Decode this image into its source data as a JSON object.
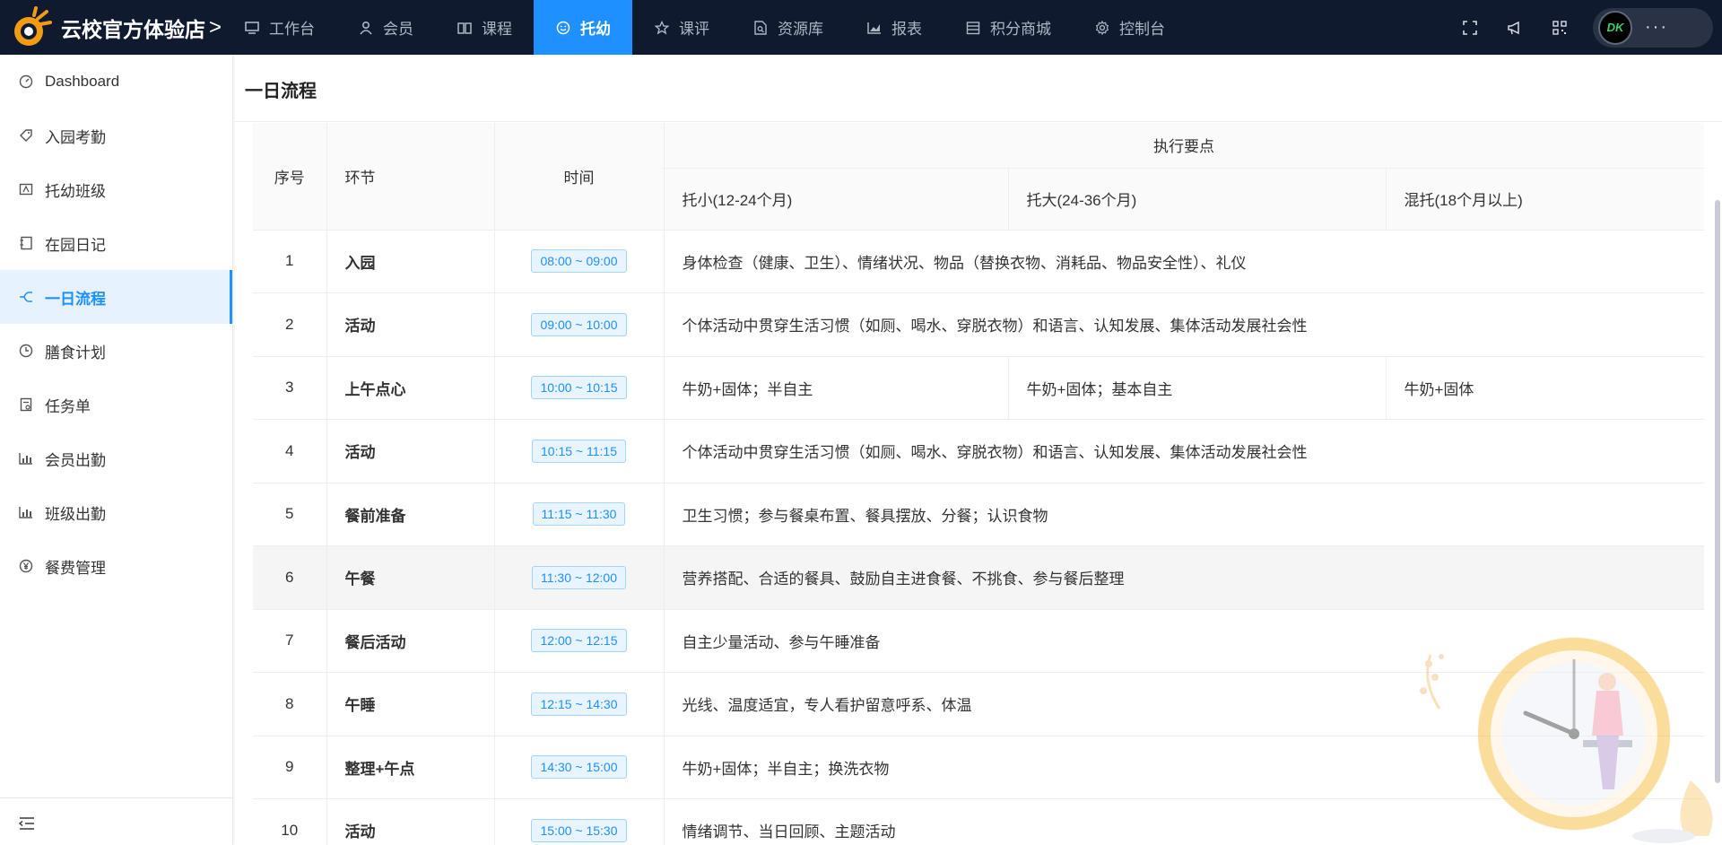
{
  "brand": {
    "name": "云校官方体验店",
    "chevron": ">"
  },
  "nav": [
    {
      "label": "工作台",
      "icon": "monitor-icon",
      "active": false
    },
    {
      "label": "会员",
      "icon": "user-icon",
      "active": false
    },
    {
      "label": "课程",
      "icon": "book-icon",
      "active": false
    },
    {
      "label": "托幼",
      "icon": "smile-icon",
      "active": true
    },
    {
      "label": "课评",
      "icon": "star-icon",
      "active": false
    },
    {
      "label": "资源库",
      "icon": "file-search-icon",
      "active": false
    },
    {
      "label": "报表",
      "icon": "chart-icon",
      "active": false
    },
    {
      "label": "积分商城",
      "icon": "shop-icon",
      "active": false
    },
    {
      "label": "控制台",
      "icon": "gear-icon",
      "active": false
    }
  ],
  "topright": {
    "avatar_text": "DK",
    "more": "···"
  },
  "sidebar": {
    "items": [
      {
        "label": "Dashboard",
        "icon": "dashboard-icon"
      },
      {
        "label": "入园考勤",
        "icon": "tag-icon"
      },
      {
        "label": "托幼班级",
        "icon": "class-icon"
      },
      {
        "label": "在园日记",
        "icon": "diary-icon"
      },
      {
        "label": "一日流程",
        "icon": "flow-icon",
        "active": true
      },
      {
        "label": "膳食计划",
        "icon": "clock-icon"
      },
      {
        "label": "任务单",
        "icon": "task-icon"
      },
      {
        "label": "会员出勤",
        "icon": "bar-chart-icon"
      },
      {
        "label": "班级出勤",
        "icon": "bar-chart-icon"
      },
      {
        "label": "餐费管理",
        "icon": "yen-icon"
      }
    ]
  },
  "page": {
    "title": "一日流程"
  },
  "table": {
    "headers": {
      "index": "序号",
      "step": "环节",
      "time": "时间",
      "exec": "执行要点",
      "sub": [
        "托小(12-24个月)",
        "托大(24-36个月)",
        "混托(18个月以上)"
      ]
    },
    "rows": [
      {
        "index": "1",
        "step": "入园",
        "time": "08:00 ~ 09:00",
        "notes": [
          "身体检查（健康、卫生）、情绪状况、物品（替换衣物、消耗品、物品安全性）、礼仪"
        ]
      },
      {
        "index": "2",
        "step": "活动",
        "time": "09:00 ~ 10:00",
        "notes": [
          "个体活动中贯穿生活习惯（如厕、喝水、穿脱衣物）和语言、认知发展、集体活动发展社会性"
        ]
      },
      {
        "index": "3",
        "step": "上午点心",
        "time": "10:00 ~ 10:15",
        "notes": [
          "牛奶+固体；半自主",
          "牛奶+固体；基本自主",
          "牛奶+固体"
        ]
      },
      {
        "index": "4",
        "step": "活动",
        "time": "10:15 ~ 11:15",
        "notes": [
          "个体活动中贯穿生活习惯（如厕、喝水、穿脱衣物）和语言、认知发展、集体活动发展社会性"
        ]
      },
      {
        "index": "5",
        "step": "餐前准备",
        "time": "11:15 ~ 11:30",
        "notes": [
          "卫生习惯；参与餐桌布置、餐具摆放、分餐；认识食物"
        ]
      },
      {
        "index": "6",
        "step": "午餐",
        "time": "11:30 ~ 12:00",
        "notes": [
          "营养搭配、合适的餐具、鼓励自主进食餐、不挑食、参与餐后整理"
        ],
        "highlight": true
      },
      {
        "index": "7",
        "step": "餐后活动",
        "time": "12:00 ~ 12:15",
        "notes": [
          "自主少量活动、参与午睡准备"
        ]
      },
      {
        "index": "8",
        "step": "午睡",
        "time": "12:15 ~ 14:30",
        "notes": [
          "光线、温度适宜，专人看护留意呼系、体温"
        ]
      },
      {
        "index": "9",
        "step": "整理+午点",
        "time": "14:30 ~ 15:00",
        "notes": [
          "牛奶+固体；半自主；换洗衣物"
        ]
      },
      {
        "index": "10",
        "step": "活动",
        "time": "15:00 ~ 15:30",
        "notes": [
          "情绪调节、当日回顾、主题活动"
        ]
      }
    ]
  },
  "colors": {
    "topbar": "#0f1a2e",
    "accent": "#1e90ff",
    "tag_bg": "#e8f4ff"
  }
}
